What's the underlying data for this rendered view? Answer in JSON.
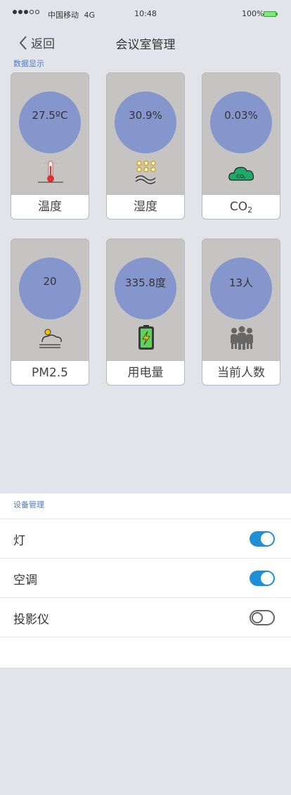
{
  "status_bar": {
    "carrier": "中国移动",
    "network": "4G",
    "time": "10:48",
    "battery": "100%"
  },
  "nav": {
    "back_label": "返回",
    "title": "会议室管理"
  },
  "data_section": {
    "label": "数据显示",
    "cards": [
      {
        "value": "27.5ºC",
        "label": "温度",
        "icon": "thermometer-icon"
      },
      {
        "value": "30.9%",
        "label": "湿度",
        "icon": "humidity-icon"
      },
      {
        "value": "0.03%",
        "label": "CO",
        "label_sub": "2",
        "icon": "co2-cloud-icon"
      },
      {
        "value": "20",
        "label": "PM2.5",
        "icon": "pm25-icon"
      },
      {
        "value": "335.8度",
        "label": "用电量",
        "icon": "battery-icon"
      },
      {
        "value": "13人",
        "label": "当前人数",
        "icon": "people-icon"
      }
    ]
  },
  "device_section": {
    "label": "设备管理",
    "devices": [
      {
        "name": "灯",
        "state": "on"
      },
      {
        "name": "空调",
        "state": "on"
      },
      {
        "name": "投影仪",
        "state": "off"
      }
    ]
  },
  "colors": {
    "accent": "#1f8fd6",
    "circle": "#8596cc",
    "card_bg": "#c6c3c3",
    "section_label": "#4a7bd0",
    "page_bg": "#e3e4e9"
  }
}
